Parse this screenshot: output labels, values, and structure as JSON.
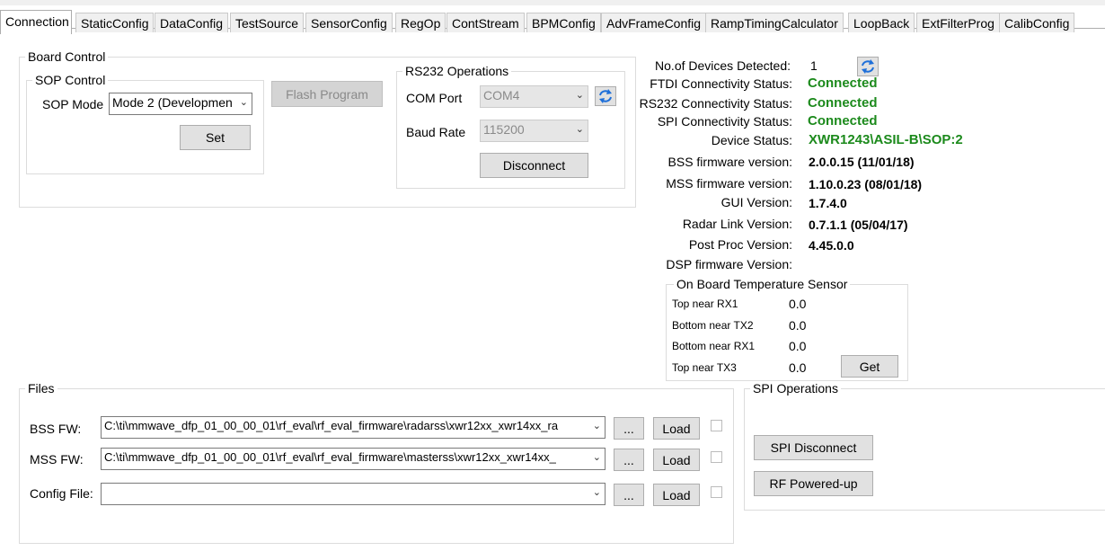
{
  "tabs": [
    "Connection",
    "StaticConfig",
    "DataConfig",
    "TestSource",
    "SensorConfig",
    "RegOp",
    "ContStream",
    "BPMConfig",
    "AdvFrameConfig",
    "RampTimingCalculator",
    "LoopBack",
    "ExtFilterProg",
    "CalibConfig"
  ],
  "board_control": {
    "title": "Board Control",
    "sop": {
      "title": "SOP Control",
      "mode_label": "SOP Mode",
      "mode_value": "Mode 2 (Developmen",
      "set_label": "Set"
    },
    "flash_label": "Flash Program",
    "rs232": {
      "title": "RS232 Operations",
      "com_label": "COM Port",
      "com_value": "COM4",
      "baud_label": "Baud Rate",
      "baud_value": "115200",
      "disconnect_label": "Disconnect"
    }
  },
  "status": {
    "devices_label": "No.of Devices Detected:",
    "devices_value": "1",
    "ftdi_label": "FTDI Connectivity Status:",
    "ftdi_value": "Connected",
    "rs232_label": "RS232 Connectivity Status:",
    "rs232_value": "Connected",
    "spi_label": "SPI Connectivity Status:",
    "spi_value": "Connected",
    "device_label": "Device Status:",
    "device_value": "XWR1243\\ASIL-B\\SOP:2",
    "bss_label": "BSS firmware version:",
    "bss_value": "2.0.0.15 (11/01/18)",
    "mss_label": "MSS firmware version:",
    "mss_value": "1.10.0.23 (08/01/18)",
    "gui_label": "GUI Version:",
    "gui_value": "1.7.4.0",
    "radar_label": "Radar Link Version:",
    "radar_value": "0.7.1.1 (05/04/17)",
    "postproc_label": "Post Proc Version:",
    "postproc_value": "4.45.0.0",
    "dsp_label": "DSP firmware Version:"
  },
  "temperature": {
    "title": "On Board Temperature Sensor",
    "rows": [
      {
        "label": "Top near RX1",
        "value": "0.0"
      },
      {
        "label": "Bottom near TX2",
        "value": "0.0"
      },
      {
        "label": "Bottom near RX1",
        "value": "0.0"
      },
      {
        "label": "Top near TX3",
        "value": "0.0"
      }
    ],
    "get_label": "Get"
  },
  "files": {
    "title": "Files",
    "rows": [
      {
        "label": "BSS FW:",
        "path": "C:\\ti\\mmwave_dfp_01_00_00_01\\rf_eval\\rf_eval_firmware\\radarss\\xwr12xx_xwr14xx_ra",
        "browse": "...",
        "load": "Load"
      },
      {
        "label": "MSS FW:",
        "path": "C:\\ti\\mmwave_dfp_01_00_00_01\\rf_eval\\rf_eval_firmware\\masterss\\xwr12xx_xwr14xx_",
        "browse": "...",
        "load": "Load"
      },
      {
        "label": "Config File:",
        "path": "",
        "browse": "...",
        "load": "Load"
      }
    ]
  },
  "spi_ops": {
    "title": "SPI Operations",
    "disconnect_label": "SPI Disconnect",
    "rf_label": "RF Powered-up"
  },
  "colors": {
    "connected": "#1c8a1c",
    "refresh_icon": "#1e6fd9"
  }
}
